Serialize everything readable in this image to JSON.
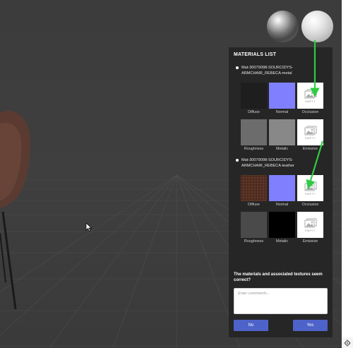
{
  "panel": {
    "title": "MATERIALS LIST",
    "materials": [
      {
        "name": "Mat-30079098-SOURCIDYS-ARMCHAIR_REBECA-metal",
        "maps": [
          {
            "label": "Diffuse",
            "state": "dark"
          },
          {
            "label": "Normal",
            "state": "normal"
          },
          {
            "label": "Occlusion",
            "state": "empty",
            "empty_text": "EMPTY"
          },
          {
            "label": "Roughness",
            "state": "texture"
          },
          {
            "label": "Metalic",
            "state": "texture"
          },
          {
            "label": "Emissive",
            "state": "empty",
            "empty_text": "EMPTY"
          }
        ]
      },
      {
        "name": "Mat-30079098-SOURCIDYS-ARMCHAIR_REBECA-leather",
        "maps": [
          {
            "label": "Diffuse",
            "state": "leather"
          },
          {
            "label": "Normal",
            "state": "normal"
          },
          {
            "label": "Occlusion",
            "state": "empty",
            "empty_text": "EMPTY"
          },
          {
            "label": "Roughness",
            "state": "texture"
          },
          {
            "label": "Metalic",
            "state": "black"
          },
          {
            "label": "Emissive",
            "state": "empty",
            "empty_text": "EMPTY"
          }
        ]
      }
    ]
  },
  "review": {
    "question": "The materials and associated textures seem correct?",
    "comments_placeholder": "Enter comments...",
    "no_label": "No",
    "yes_label": "Yes"
  },
  "colors": {
    "accent": "#4e63c9",
    "annotation_arrow": "#2ecc40",
    "panel_bg": "#262626",
    "normal_map": "#8080ff"
  },
  "icons": {
    "empty_texture": "image-placeholder-icon",
    "settings": "gear-icon",
    "cursor": "mouse-pointer-icon"
  }
}
